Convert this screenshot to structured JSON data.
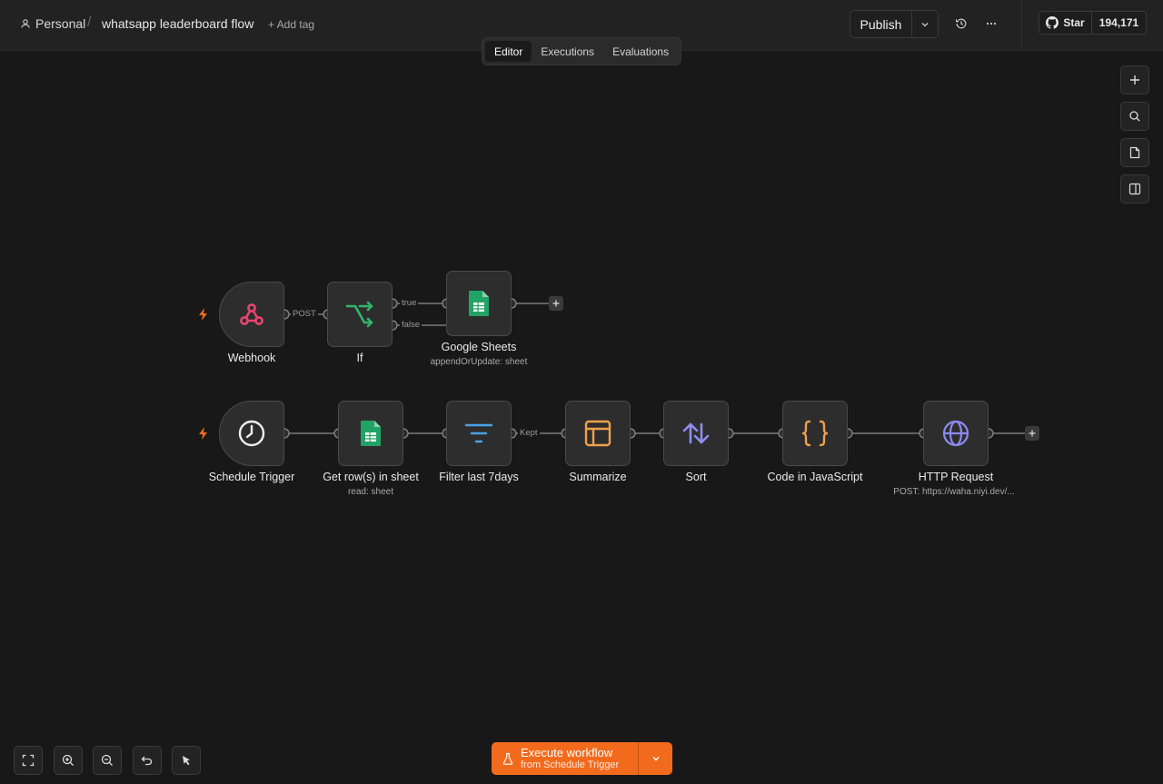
{
  "header": {
    "project": "Personal",
    "workflow_title": "whatsapp leaderboard flow",
    "add_tag": "+ Add tag",
    "publish_label": "Publish",
    "github_star_label": "Star",
    "github_star_count": "194,171"
  },
  "tabs": [
    {
      "label": "Editor",
      "active": true
    },
    {
      "label": "Executions",
      "active": false
    },
    {
      "label": "Evaluations",
      "active": false
    }
  ],
  "nodes": {
    "webhook": {
      "label": "Webhook",
      "icon": "webhook-icon"
    },
    "if": {
      "label": "If",
      "icon": "if-branch-icon"
    },
    "google_sheets": {
      "label": "Google Sheets",
      "sub": "appendOrUpdate: sheet",
      "icon": "google-sheets-icon"
    },
    "schedule": {
      "label": "Schedule Trigger",
      "icon": "clock-icon"
    },
    "get_rows": {
      "label": "Get row(s) in sheet",
      "sub": "read: sheet",
      "icon": "google-sheets-icon"
    },
    "filter": {
      "label": "Filter last 7days",
      "icon": "filter-icon"
    },
    "summarize": {
      "label": "Summarize",
      "icon": "summarize-icon"
    },
    "sort": {
      "label": "Sort",
      "icon": "sort-icon"
    },
    "code": {
      "label": "Code in JavaScript",
      "icon": "code-braces-icon"
    },
    "http": {
      "label": "HTTP Request",
      "sub": "POST: https://waha.niyi.dev/...",
      "icon": "globe-icon"
    }
  },
  "edge_labels": {
    "webhook_post": "POST",
    "if_true": "true",
    "if_false": "false",
    "filter_kept": "Kept"
  },
  "execute": {
    "label": "Execute workflow",
    "sub": "from Schedule Trigger"
  },
  "colors": {
    "accent": "#f26b1d",
    "webhook": "#e8466f",
    "sheets": "#21a366",
    "filter": "#4aa3e8",
    "summarize": "#f0a04b",
    "sort": "#8f8ff0",
    "code": "#f0a04b",
    "http": "#8a8af0"
  }
}
